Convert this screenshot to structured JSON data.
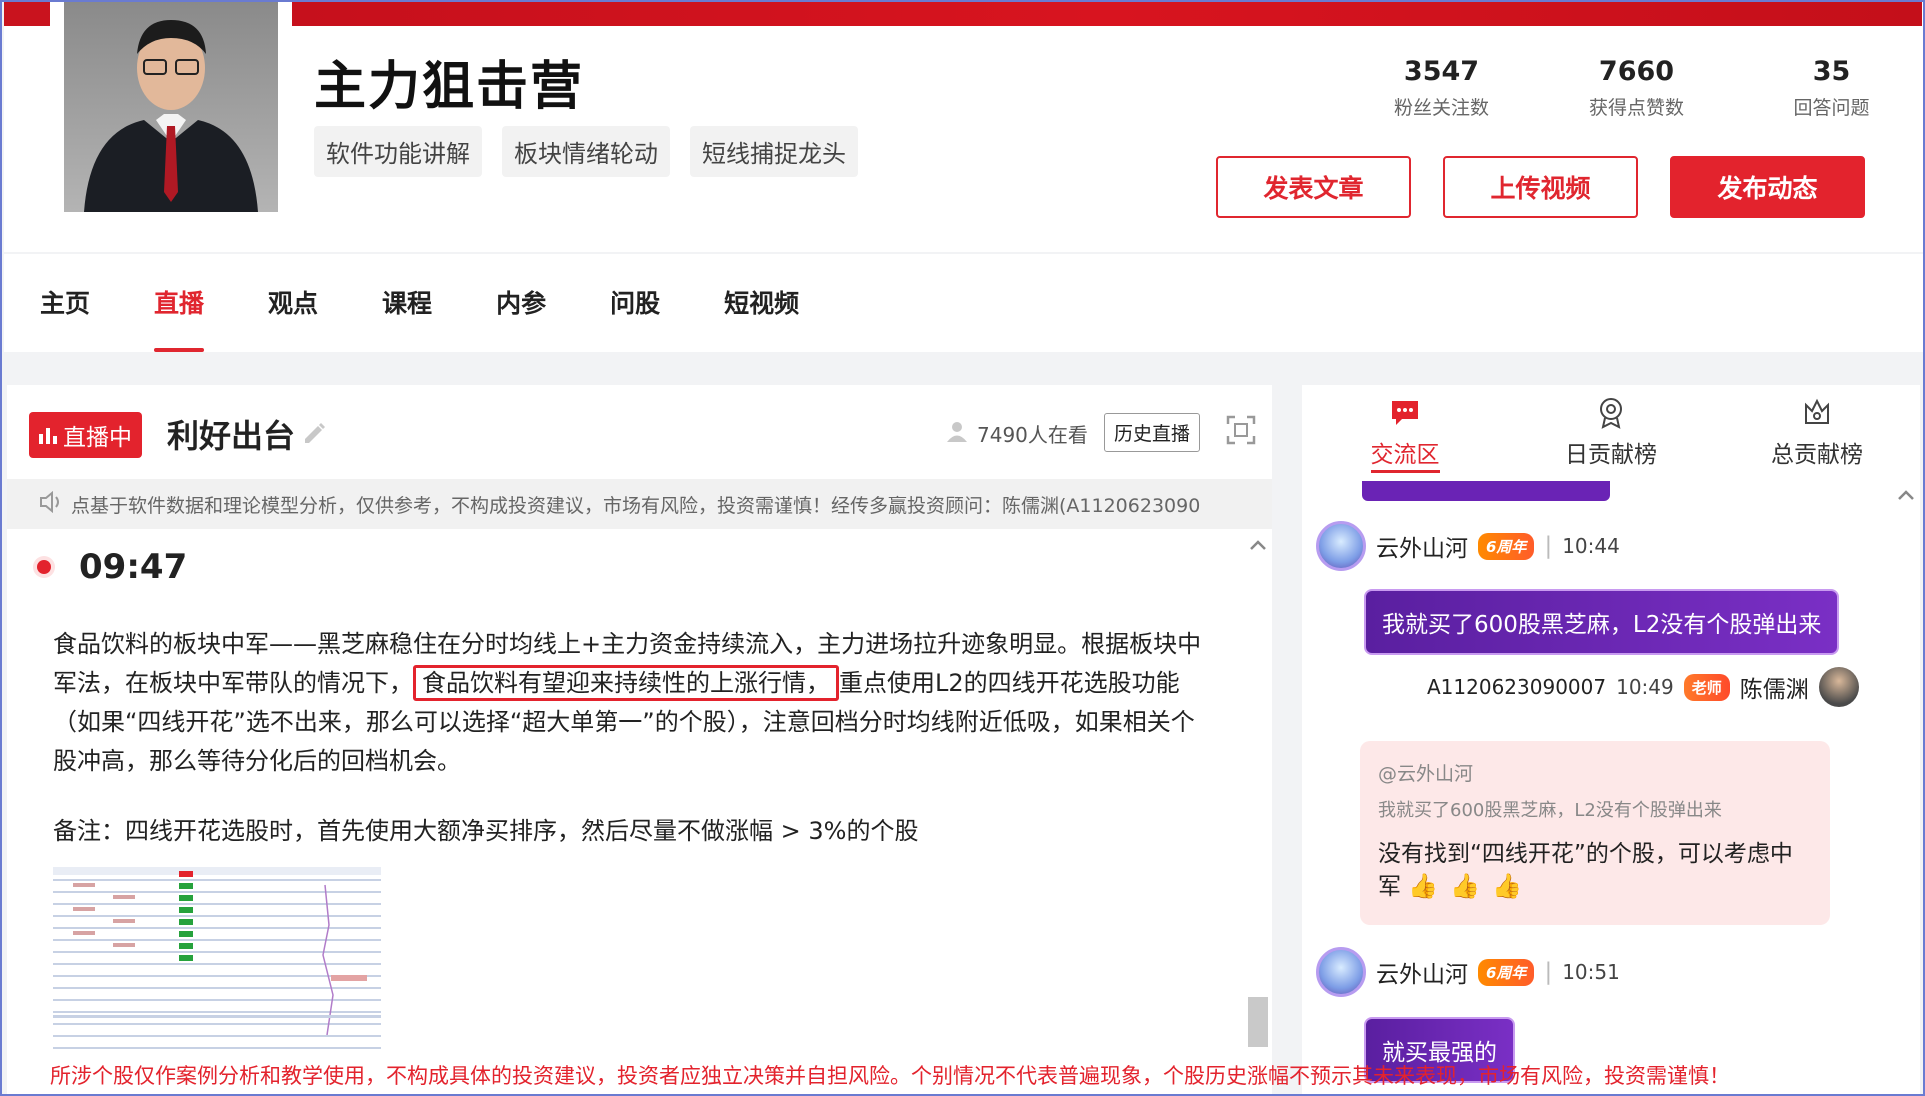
{
  "profile": {
    "name": "主力狙击营",
    "tags": [
      "软件功能讲解",
      "板块情绪轮动",
      "短线捕捉龙头"
    ],
    "stats": [
      {
        "value": "3547",
        "label": "粉丝关注数"
      },
      {
        "value": "7660",
        "label": "获得点赞数"
      },
      {
        "value": "35",
        "label": "回答问题"
      }
    ],
    "actions": {
      "post_article": "发表文章",
      "upload_video": "上传视频",
      "publish_status": "发布动态"
    }
  },
  "nav": {
    "items": [
      "主页",
      "直播",
      "观点",
      "课程",
      "内参",
      "问股",
      "短视频"
    ],
    "active": "直播"
  },
  "live": {
    "badge": "直播中",
    "title": "利好出台",
    "viewers": "7490人在看",
    "history_button": "历史直播",
    "notice": "点基于软件数据和理论模型分析，仅供参考，不构成投资建议，市场有风险，投资需谨慎！经传多赢投资顾问：陈儒渊(A1120623090",
    "post": {
      "time": "09:47",
      "text_before": "食品饮料的板块中军——黑芝麻稳住在分时均线上+主力资金持续流入，主力进场拉升迹象明显。根据板块中军法，在板块中军带队的情况下，",
      "text_highlight": "食品饮料有望迎来持续性的上涨行情，",
      "text_after": "重点使用L2的四线开花选股功能（如果“四线开花”选不出来，那么可以选择“超大单第一”的个股），注意回档分时均线附近低吸，如果相关个股冲高，那么等待分化后的回档机会。",
      "remark": "备注：四线开花选股时，首先使用大额净买排序，然后尽量不做涨幅 > 3%的个股"
    },
    "disclaimer": "所涉个股仅作案例分析和教学使用，不构成具体的投资建议，投资者应独立决策并自担风险。个别情况不代表普遍现象，个股历史涨幅不预示其未来表现，市场有风险，投资需谨慎！"
  },
  "side": {
    "tabs": [
      "交流区",
      "日贡献榜",
      "总贡献榜"
    ],
    "active_tab": "交流区",
    "messages": [
      {
        "user": "云外山河",
        "badge": "6周年",
        "time": "10:44",
        "text": "我就买了600股黑芝麻，L2没有个股弹出来"
      },
      {
        "advisor_id": "A1120623090007",
        "time": "10:49",
        "badge": "老师",
        "name": "陈儒渊",
        "quote_user": "@云外山河",
        "quote_text": "我就买了600股黑芝麻，L2没有个股弹出来",
        "reply": "没有找到“四线开花”的个股，可以考虑中军"
      },
      {
        "user": "云外山河",
        "badge": "6周年",
        "time": "10:51",
        "text": "就买最强的"
      }
    ]
  },
  "colors": {
    "brand_red": "#e3232d",
    "chat_purple": "#6a23b5",
    "reply_pink": "#fde8e8"
  }
}
